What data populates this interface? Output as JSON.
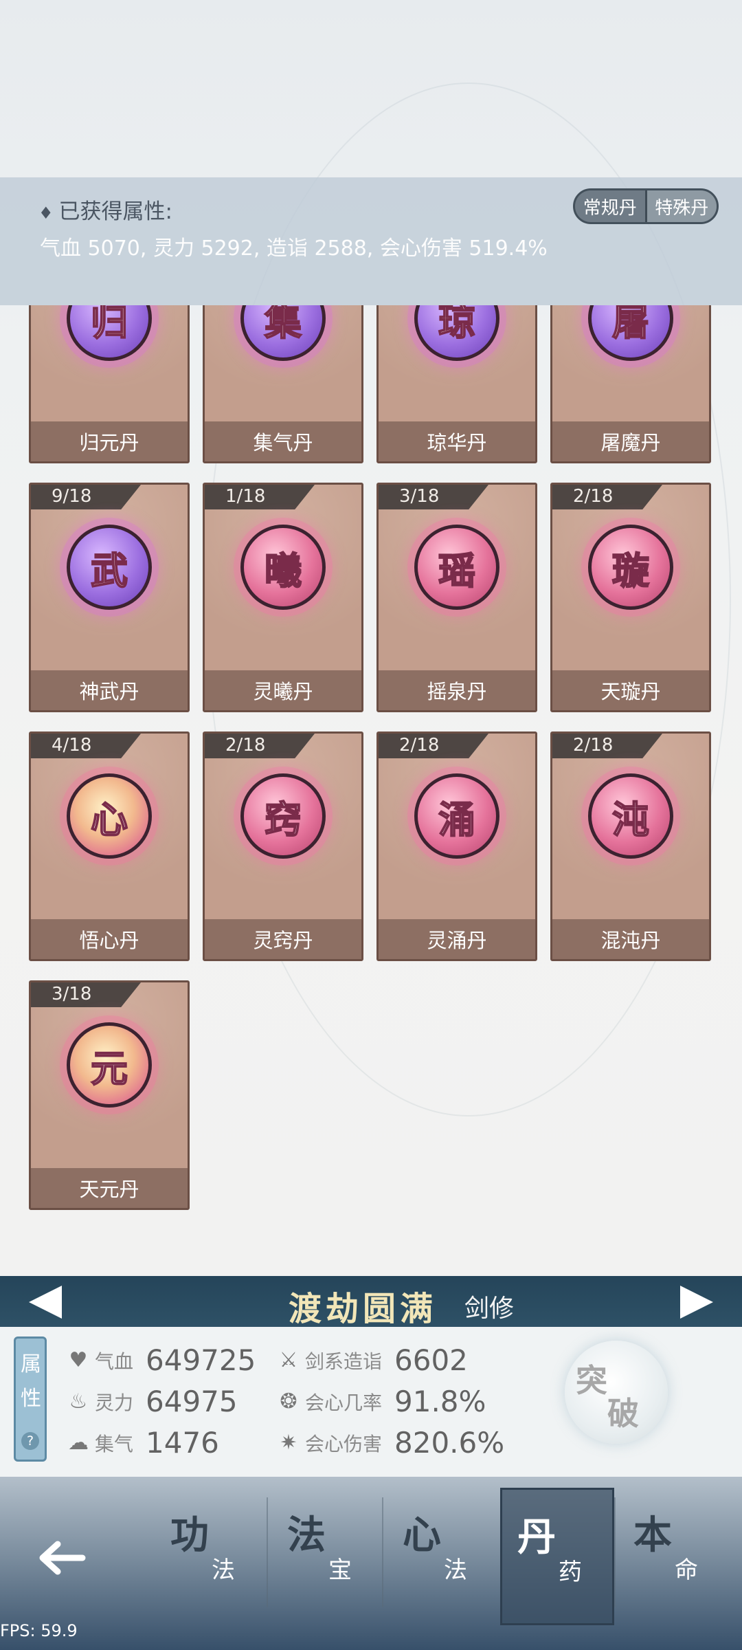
{
  "attributes_panel": {
    "title": "已获得属性:",
    "values": "气血 5070, 灵力 5292, 造诣 2588, 会心伤害 519.4%",
    "tabs": [
      "常规丹",
      "特殊丹"
    ]
  },
  "pills": [
    {
      "name": "归元丹",
      "glyph": "归",
      "count": "",
      "color": "purple"
    },
    {
      "name": "集气丹",
      "glyph": "集",
      "count": "",
      "color": "purple"
    },
    {
      "name": "琼华丹",
      "glyph": "琼",
      "count": "",
      "color": "purple"
    },
    {
      "name": "屠魔丹",
      "glyph": "屠",
      "count": "",
      "color": "purple"
    },
    {
      "name": "神武丹",
      "glyph": "武",
      "count": "9/18",
      "color": "purple"
    },
    {
      "name": "灵曦丹",
      "glyph": "曦",
      "count": "1/18",
      "color": "pink"
    },
    {
      "name": "摇泉丹",
      "glyph": "瑶",
      "count": "3/18",
      "color": "pink"
    },
    {
      "name": "天璇丹",
      "glyph": "璇",
      "count": "2/18",
      "color": "pink"
    },
    {
      "name": "悟心丹",
      "glyph": "心",
      "count": "4/18",
      "color": "gold"
    },
    {
      "name": "灵窍丹",
      "glyph": "窍",
      "count": "2/18",
      "color": "pink"
    },
    {
      "name": "灵涌丹",
      "glyph": "涌",
      "count": "2/18",
      "color": "pink"
    },
    {
      "name": "混沌丹",
      "glyph": "沌",
      "count": "2/18",
      "color": "pink"
    },
    {
      "name": "天元丹",
      "glyph": "元",
      "count": "3/18",
      "color": "gold"
    }
  ],
  "realm": {
    "name": "渡劫圆满",
    "class": "剑修"
  },
  "stats": {
    "tab_label_1": "属",
    "tab_label_2": "性",
    "help": "?",
    "items": [
      {
        "label": "气血",
        "value": "649725",
        "icon": "heart-icon"
      },
      {
        "label": "灵力",
        "value": "64975",
        "icon": "flame-icon"
      },
      {
        "label": "集气",
        "value": "1476",
        "icon": "swirl-icon"
      },
      {
        "label": "剑系造诣",
        "value": "6602",
        "icon": "sword-icon"
      },
      {
        "label": "会心几率",
        "value": "91.8%",
        "icon": "crit-rate-icon"
      },
      {
        "label": "会心伤害",
        "value": "820.6%",
        "icon": "crit-damage-icon"
      }
    ],
    "breakthrough_1": "突",
    "breakthrough_2": "破"
  },
  "nav": {
    "items": [
      {
        "big": "功",
        "small": "法"
      },
      {
        "big": "法",
        "small": "宝"
      },
      {
        "big": "心",
        "small": "法"
      },
      {
        "big": "丹",
        "small": "药"
      },
      {
        "big": "本",
        "small": "命"
      }
    ],
    "active_index": 3
  },
  "fps": "FPS: 59.9"
}
